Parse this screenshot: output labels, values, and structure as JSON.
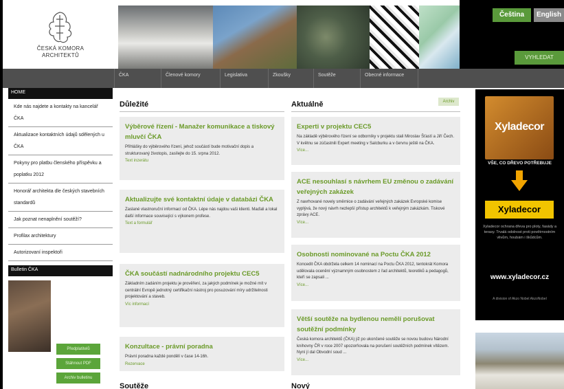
{
  "logo": {
    "line1": "ČESKÁ KOMORA",
    "line2": "ARCHITEKTŮ"
  },
  "header": {
    "lang_cz": "Čeština",
    "lang_en": "English",
    "search": "VYHLEDAT"
  },
  "nav": [
    "ČKA",
    "Členové komory",
    "Legislativa",
    "Zkoušky",
    "Soutěže",
    "Obecné informace"
  ],
  "sidebar": {
    "home": "HOME",
    "items": [
      "Kde nás najdete a kontakty na kancelář ČKA",
      "Aktualizace kontaktních údajů sdělených u ČKA",
      "Pokyny pro platbu členského příspěvku a poplatku 2012",
      "Honorář architekta dle českých stavebních standardů",
      "Jak poznat nenaplnění soutěží?",
      "Profilax architektury",
      "Autorizovaní inspektoři"
    ],
    "bulletin_head": "Bulletin ČKA",
    "buttons": [
      "Předplatitelů",
      "Stáhnout PDF",
      "Archiv bulletinu"
    ]
  },
  "important": {
    "title": "Důležité",
    "boxes": [
      {
        "title": "Výběrové řízení - Manažer komunikace a tiskový mluvčí ČKA",
        "text": "Přihlášky do výběrového řízení, jehož součástí bude motivační dopis a strukturovaný životopis, zasílejte do 15. srpna 2012.",
        "link": "Text inzerátu"
      },
      {
        "title": "Aktualizujte své kontaktní údaje v databázi ČKA",
        "text": "Zaslané vlastnoruční informací od ČKA. Lépe nás najdou vaši klienti. Maďali a lokal další informace související s výkonem profese.",
        "link": "Text a formulář"
      },
      {
        "title": "ČKA součástí nadnárodního projektu CEC5",
        "text": "Základním zadáním projektu je prověření, za jakých podmínek je možné mít v centrální Evropě jednotný certifikační nástroj pro posuzování míry udržitelnosti projektování a staveb.",
        "link": "Víc informací"
      },
      {
        "title": "Konzultace - právní poradna",
        "text": "Právní poradna každé pondělí v čase 14-16h.",
        "link": "Rezervace"
      }
    ],
    "next_title": "Soutěže"
  },
  "news": {
    "title": "Aktuálně",
    "archive": "Archiv",
    "boxes": [
      {
        "title": "Experti v projektu CEC5",
        "text": "Na základě výběrového řízení se odborníky v projektu stali Miroslav Šťastí a Jiří Čech. V květnu se zúčastnili Expert meeting v Salcburku a v červnu ještě na ČKA.",
        "link": "Více..."
      },
      {
        "title": "ACE nesouhlasí s návrhem EU změnou o zadávání veřejných zakázek",
        "text": "Z navrhované novely směrnice o zadávání veřejných zakázek Evropské komise vyplývá, že nový návrh nezlepší přístup architektů k veřejným zakázkám. Tiskové zprávy ACE.",
        "link": "Více..."
      },
      {
        "title": "Osobnosti nominované na Poctu ČKA 2012",
        "text": "Koncedit ČKA obdržela celkem 14 nominací na Poctu ČKA 2012, tentokrát Komora udělovala ocenění významným osobnostem z řad architektů, teoretiků a pedagogů, kteří se zapsali ...",
        "link": "Více..."
      },
      {
        "title": "Větší soutěže na bydlenou nemělí porušovat soutěžní podmínky",
        "text": "Česká komora architektů (ČKA) již po ukončené soutěže se novou budovu Národní knihovny ČR v roce 2007 upozorňovala na porušení soutěžních podmínek vítězem. Nyní jí dal Obvodní soud ...",
        "link": "Více..."
      }
    ],
    "next_title": "Nový"
  },
  "ad": {
    "brand": "Xyladecor",
    "slogan": "VŠE, CO DŘEVO POTŘEBUJE",
    "small": "Xyladecor ochrana dřeva pro ploty, fasády a terasy. Trvalá odolnost proti povětrnostním vlivům, houbám i škůdcům.",
    "url": "www.xyladecor.cz",
    "footer": "A division of Akzo Nobel AkzoNobel",
    "colors": {
      "orange": "#d38c2e",
      "yellow": "#f2c400"
    }
  }
}
